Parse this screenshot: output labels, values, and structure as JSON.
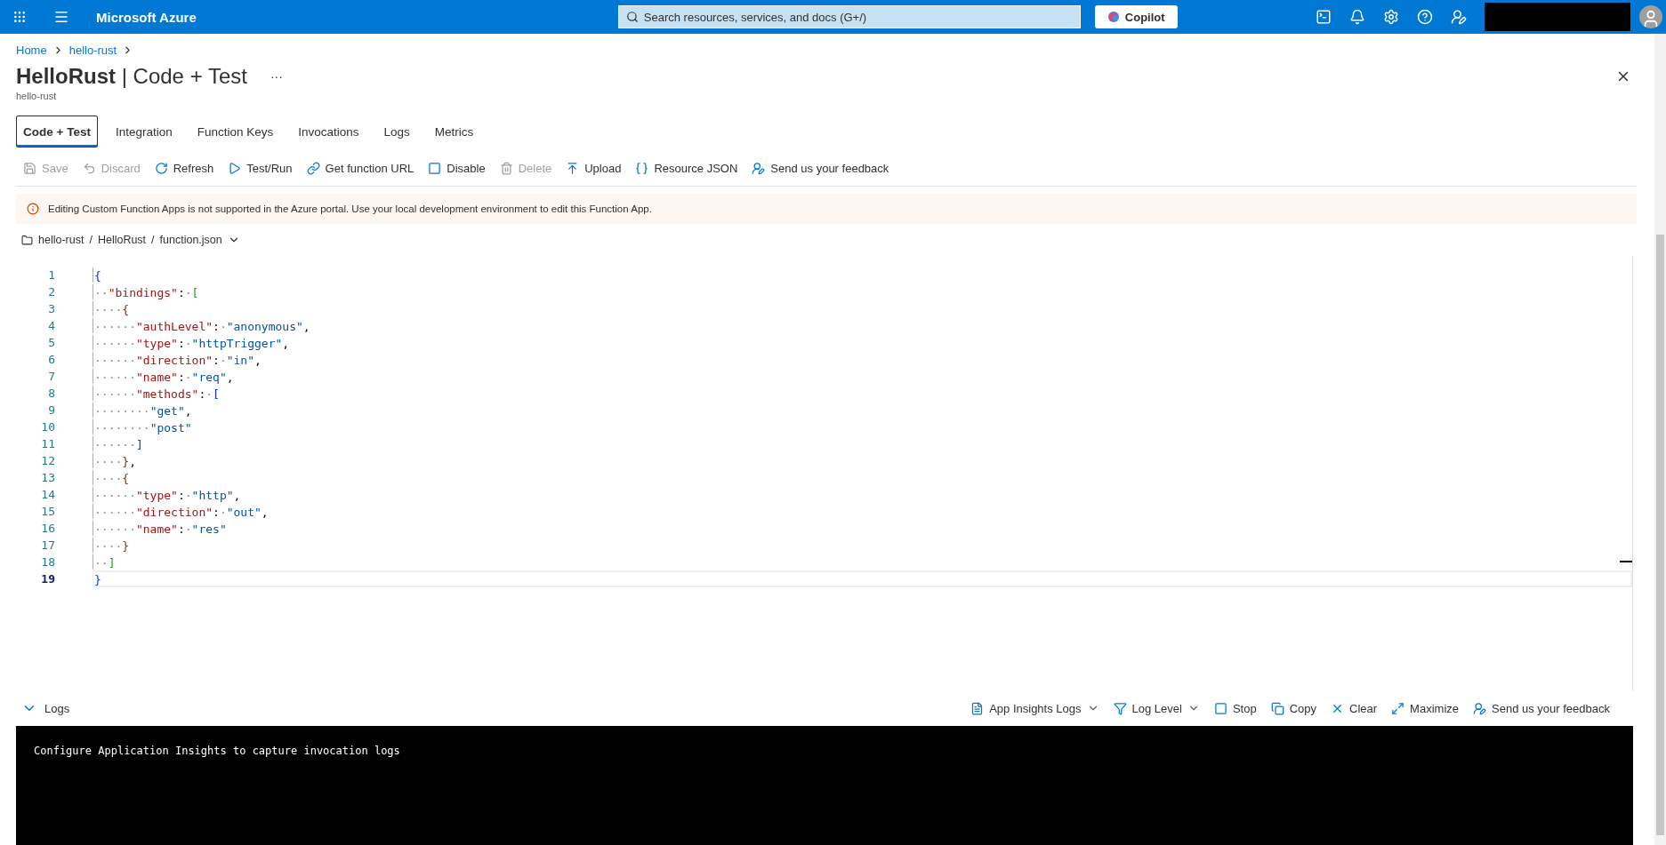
{
  "topbar": {
    "brand": "Microsoft Azure",
    "search": {
      "placeholder": "Search resources, services, and docs (G+/)"
    },
    "copilot": "Copilot"
  },
  "breadcrumb": [
    "Home",
    "hello-rust"
  ],
  "header": {
    "title": "HelloRust",
    "separator": "|",
    "subtitle_part": "Code + Test",
    "more": "···",
    "resource": "hello-rust"
  },
  "tabs": [
    {
      "label": "Code + Test",
      "selected": true
    },
    {
      "label": "Integration",
      "selected": false
    },
    {
      "label": "Function Keys",
      "selected": false
    },
    {
      "label": "Invocations",
      "selected": false
    },
    {
      "label": "Logs",
      "selected": false
    },
    {
      "label": "Metrics",
      "selected": false
    }
  ],
  "toolbar": [
    {
      "label": "Save",
      "disabled": true
    },
    {
      "label": "Discard",
      "disabled": true
    },
    {
      "label": "Refresh",
      "disabled": false
    },
    {
      "label": "Test/Run",
      "disabled": false
    },
    {
      "label": "Get function URL",
      "disabled": false
    },
    {
      "label": "Disable",
      "disabled": false
    },
    {
      "label": "Delete",
      "disabled": true
    },
    {
      "label": "Upload",
      "disabled": false
    },
    {
      "label": "Resource JSON",
      "disabled": false
    },
    {
      "label": "Send us your feedback",
      "disabled": false
    }
  ],
  "banner": "Editing Custom Function Apps is not supported in the Azure portal. Use your local development environment to edit this Function App.",
  "file_path": {
    "separator": "/",
    "parts": [
      "hello-rust",
      "HelloRust",
      "function.json"
    ]
  },
  "code_lines": [
    {
      "number": "1",
      "current": false,
      "tokens": [
        {
          "kind": "brace1",
          "text": "{"
        }
      ]
    },
    {
      "number": "2",
      "current": false,
      "tokens": [
        {
          "kind": "ws",
          "text": "··"
        },
        {
          "kind": "key",
          "text": "\"bindings\""
        },
        {
          "kind": "punct",
          "text": ":"
        },
        {
          "kind": "ws",
          "text": "·"
        },
        {
          "kind": "brace2",
          "text": "["
        }
      ]
    },
    {
      "number": "3",
      "current": false,
      "tokens": [
        {
          "kind": "ws",
          "text": "····"
        },
        {
          "kind": "brace3",
          "text": "{"
        }
      ]
    },
    {
      "number": "4",
      "current": false,
      "tokens": [
        {
          "kind": "ws",
          "text": "······"
        },
        {
          "kind": "key",
          "text": "\"authLevel\""
        },
        {
          "kind": "punct",
          "text": ":"
        },
        {
          "kind": "ws",
          "text": "·"
        },
        {
          "kind": "string",
          "text": "\"anonymous\""
        },
        {
          "kind": "punct",
          "text": ","
        }
      ]
    },
    {
      "number": "5",
      "current": false,
      "tokens": [
        {
          "kind": "ws",
          "text": "······"
        },
        {
          "kind": "key",
          "text": "\"type\""
        },
        {
          "kind": "punct",
          "text": ":"
        },
        {
          "kind": "ws",
          "text": "·"
        },
        {
          "kind": "string",
          "text": "\"httpTrigger\""
        },
        {
          "kind": "punct",
          "text": ","
        }
      ]
    },
    {
      "number": "6",
      "current": false,
      "tokens": [
        {
          "kind": "ws",
          "text": "······"
        },
        {
          "kind": "key",
          "text": "\"direction\""
        },
        {
          "kind": "punct",
          "text": ":"
        },
        {
          "kind": "ws",
          "text": "·"
        },
        {
          "kind": "string",
          "text": "\"in\""
        },
        {
          "kind": "punct",
          "text": ","
        }
      ]
    },
    {
      "number": "7",
      "current": false,
      "tokens": [
        {
          "kind": "ws",
          "text": "······"
        },
        {
          "kind": "key",
          "text": "\"name\""
        },
        {
          "kind": "punct",
          "text": ":"
        },
        {
          "kind": "ws",
          "text": "·"
        },
        {
          "kind": "string",
          "text": "\"req\""
        },
        {
          "kind": "punct",
          "text": ","
        }
      ]
    },
    {
      "number": "8",
      "current": false,
      "tokens": [
        {
          "kind": "ws",
          "text": "······"
        },
        {
          "kind": "key",
          "text": "\"methods\""
        },
        {
          "kind": "punct",
          "text": ":"
        },
        {
          "kind": "ws",
          "text": "·"
        },
        {
          "kind": "brace1",
          "text": "["
        }
      ]
    },
    {
      "number": "9",
      "current": false,
      "tokens": [
        {
          "kind": "ws",
          "text": "········"
        },
        {
          "kind": "string",
          "text": "\"get\""
        },
        {
          "kind": "punct",
          "text": ","
        }
      ]
    },
    {
      "number": "10",
      "current": false,
      "tokens": [
        {
          "kind": "ws",
          "text": "········"
        },
        {
          "kind": "string",
          "text": "\"post\""
        }
      ]
    },
    {
      "number": "11",
      "current": false,
      "tokens": [
        {
          "kind": "ws",
          "text": "······"
        },
        {
          "kind": "brace1",
          "text": "]"
        }
      ]
    },
    {
      "number": "12",
      "current": false,
      "tokens": [
        {
          "kind": "ws",
          "text": "····"
        },
        {
          "kind": "brace3",
          "text": "}"
        },
        {
          "kind": "punct",
          "text": ","
        }
      ]
    },
    {
      "number": "13",
      "current": false,
      "tokens": [
        {
          "kind": "ws",
          "text": "····"
        },
        {
          "kind": "brace3",
          "text": "{"
        }
      ]
    },
    {
      "number": "14",
      "current": false,
      "tokens": [
        {
          "kind": "ws",
          "text": "······"
        },
        {
          "kind": "key",
          "text": "\"type\""
        },
        {
          "kind": "punct",
          "text": ":"
        },
        {
          "kind": "ws",
          "text": "·"
        },
        {
          "kind": "string",
          "text": "\"http\""
        },
        {
          "kind": "punct",
          "text": ","
        }
      ]
    },
    {
      "number": "15",
      "current": false,
      "tokens": [
        {
          "kind": "ws",
          "text": "······"
        },
        {
          "kind": "key",
          "text": "\"direction\""
        },
        {
          "kind": "punct",
          "text": ":"
        },
        {
          "kind": "ws",
          "text": "·"
        },
        {
          "kind": "string",
          "text": "\"out\""
        },
        {
          "kind": "punct",
          "text": ","
        }
      ]
    },
    {
      "number": "16",
      "current": false,
      "tokens": [
        {
          "kind": "ws",
          "text": "······"
        },
        {
          "kind": "key",
          "text": "\"name\""
        },
        {
          "kind": "punct",
          "text": ":"
        },
        {
          "kind": "ws",
          "text": "·"
        },
        {
          "kind": "string",
          "text": "\"res\""
        }
      ]
    },
    {
      "number": "17",
      "current": false,
      "tokens": [
        {
          "kind": "ws",
          "text": "····"
        },
        {
          "kind": "brace3",
          "text": "}"
        }
      ]
    },
    {
      "number": "18",
      "current": false,
      "tokens": [
        {
          "kind": "ws",
          "text": "··"
        },
        {
          "kind": "brace2",
          "text": "]"
        }
      ]
    },
    {
      "number": "19",
      "current": true,
      "tokens": [
        {
          "kind": "brace1",
          "text": "}"
        }
      ]
    }
  ],
  "logs": {
    "title": "Logs",
    "expanded": true,
    "actions": [
      {
        "label": "App Insights Logs",
        "dropdown": true
      },
      {
        "label": "Log Level",
        "dropdown": true
      },
      {
        "label": "Stop",
        "dropdown": false
      },
      {
        "label": "Copy",
        "dropdown": false
      },
      {
        "label": "Clear",
        "dropdown": false
      },
      {
        "label": "Maximize",
        "dropdown": false
      },
      {
        "label": "Send us your feedback",
        "dropdown": false
      }
    ],
    "output": "Configure Application Insights to capture invocation logs"
  }
}
